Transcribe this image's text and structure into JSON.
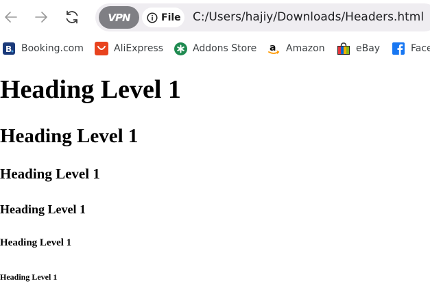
{
  "browser": {
    "vpn_label": "VPN",
    "site_info_label": "File",
    "address_url": "C:/Users/hajiy/Downloads/Headers.html",
    "icons": {
      "back": "arrow-left-icon",
      "forward": "arrow-right-icon",
      "reload": "reload-icon",
      "site_info": "info-icon"
    }
  },
  "bookmarks": [
    {
      "label": "Booking.com",
      "icon": "booking-icon",
      "color": "#1a3a7a"
    },
    {
      "label": "AliExpress",
      "icon": "aliexpress-icon",
      "color": "#e8431e"
    },
    {
      "label": "Addons Store",
      "icon": "addons-store-icon",
      "color": "#1f8a50"
    },
    {
      "label": "Amazon",
      "icon": "amazon-icon",
      "color": "#ff9900"
    },
    {
      "label": "eBay",
      "icon": "ebay-icon",
      "color": "#e53238"
    },
    {
      "label": "Face",
      "icon": "facebook-icon",
      "color": "#1877f2"
    }
  ],
  "page": {
    "headings": [
      "Heading Level 1",
      "Heading Level 1",
      "Heading Level 1",
      "Heading Level 1",
      "Heading Level 1",
      "Heading Level 1"
    ]
  }
}
